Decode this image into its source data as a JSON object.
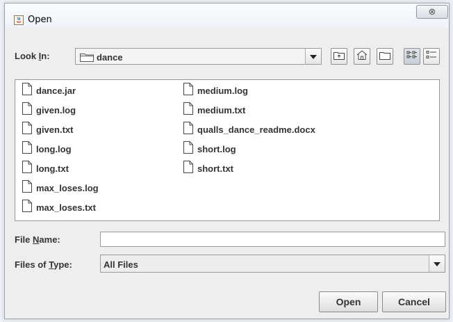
{
  "window": {
    "title": "Open",
    "close_symbol": "⊗"
  },
  "look_in": {
    "label_prefix": "Look ",
    "label_mnemonic": "I",
    "label_suffix": "n:",
    "value": "dance"
  },
  "toolbar": {
    "buttons": [
      "up-one-level",
      "home",
      "new-folder",
      "list-view",
      "details-view"
    ]
  },
  "files": {
    "column1": [
      "dance.jar",
      "given.log",
      "given.txt",
      "long.log",
      "long.txt",
      "max_loses.log",
      "max_loses.txt"
    ],
    "column2": [
      "medium.log",
      "medium.txt",
      "qualls_dance_readme.docx",
      "short.log",
      "short.txt"
    ]
  },
  "file_name": {
    "label_prefix": "File ",
    "label_mnemonic": "N",
    "label_suffix": "ame:",
    "value": ""
  },
  "file_type": {
    "label_prefix": "Files of ",
    "label_mnemonic": "T",
    "label_suffix": "ype:",
    "value": "All Files"
  },
  "buttons": {
    "open": "Open",
    "cancel": "Cancel"
  },
  "colors": {
    "window_bg": "#eeeeee",
    "text": "#333333",
    "list_bg": "#ffffff"
  }
}
